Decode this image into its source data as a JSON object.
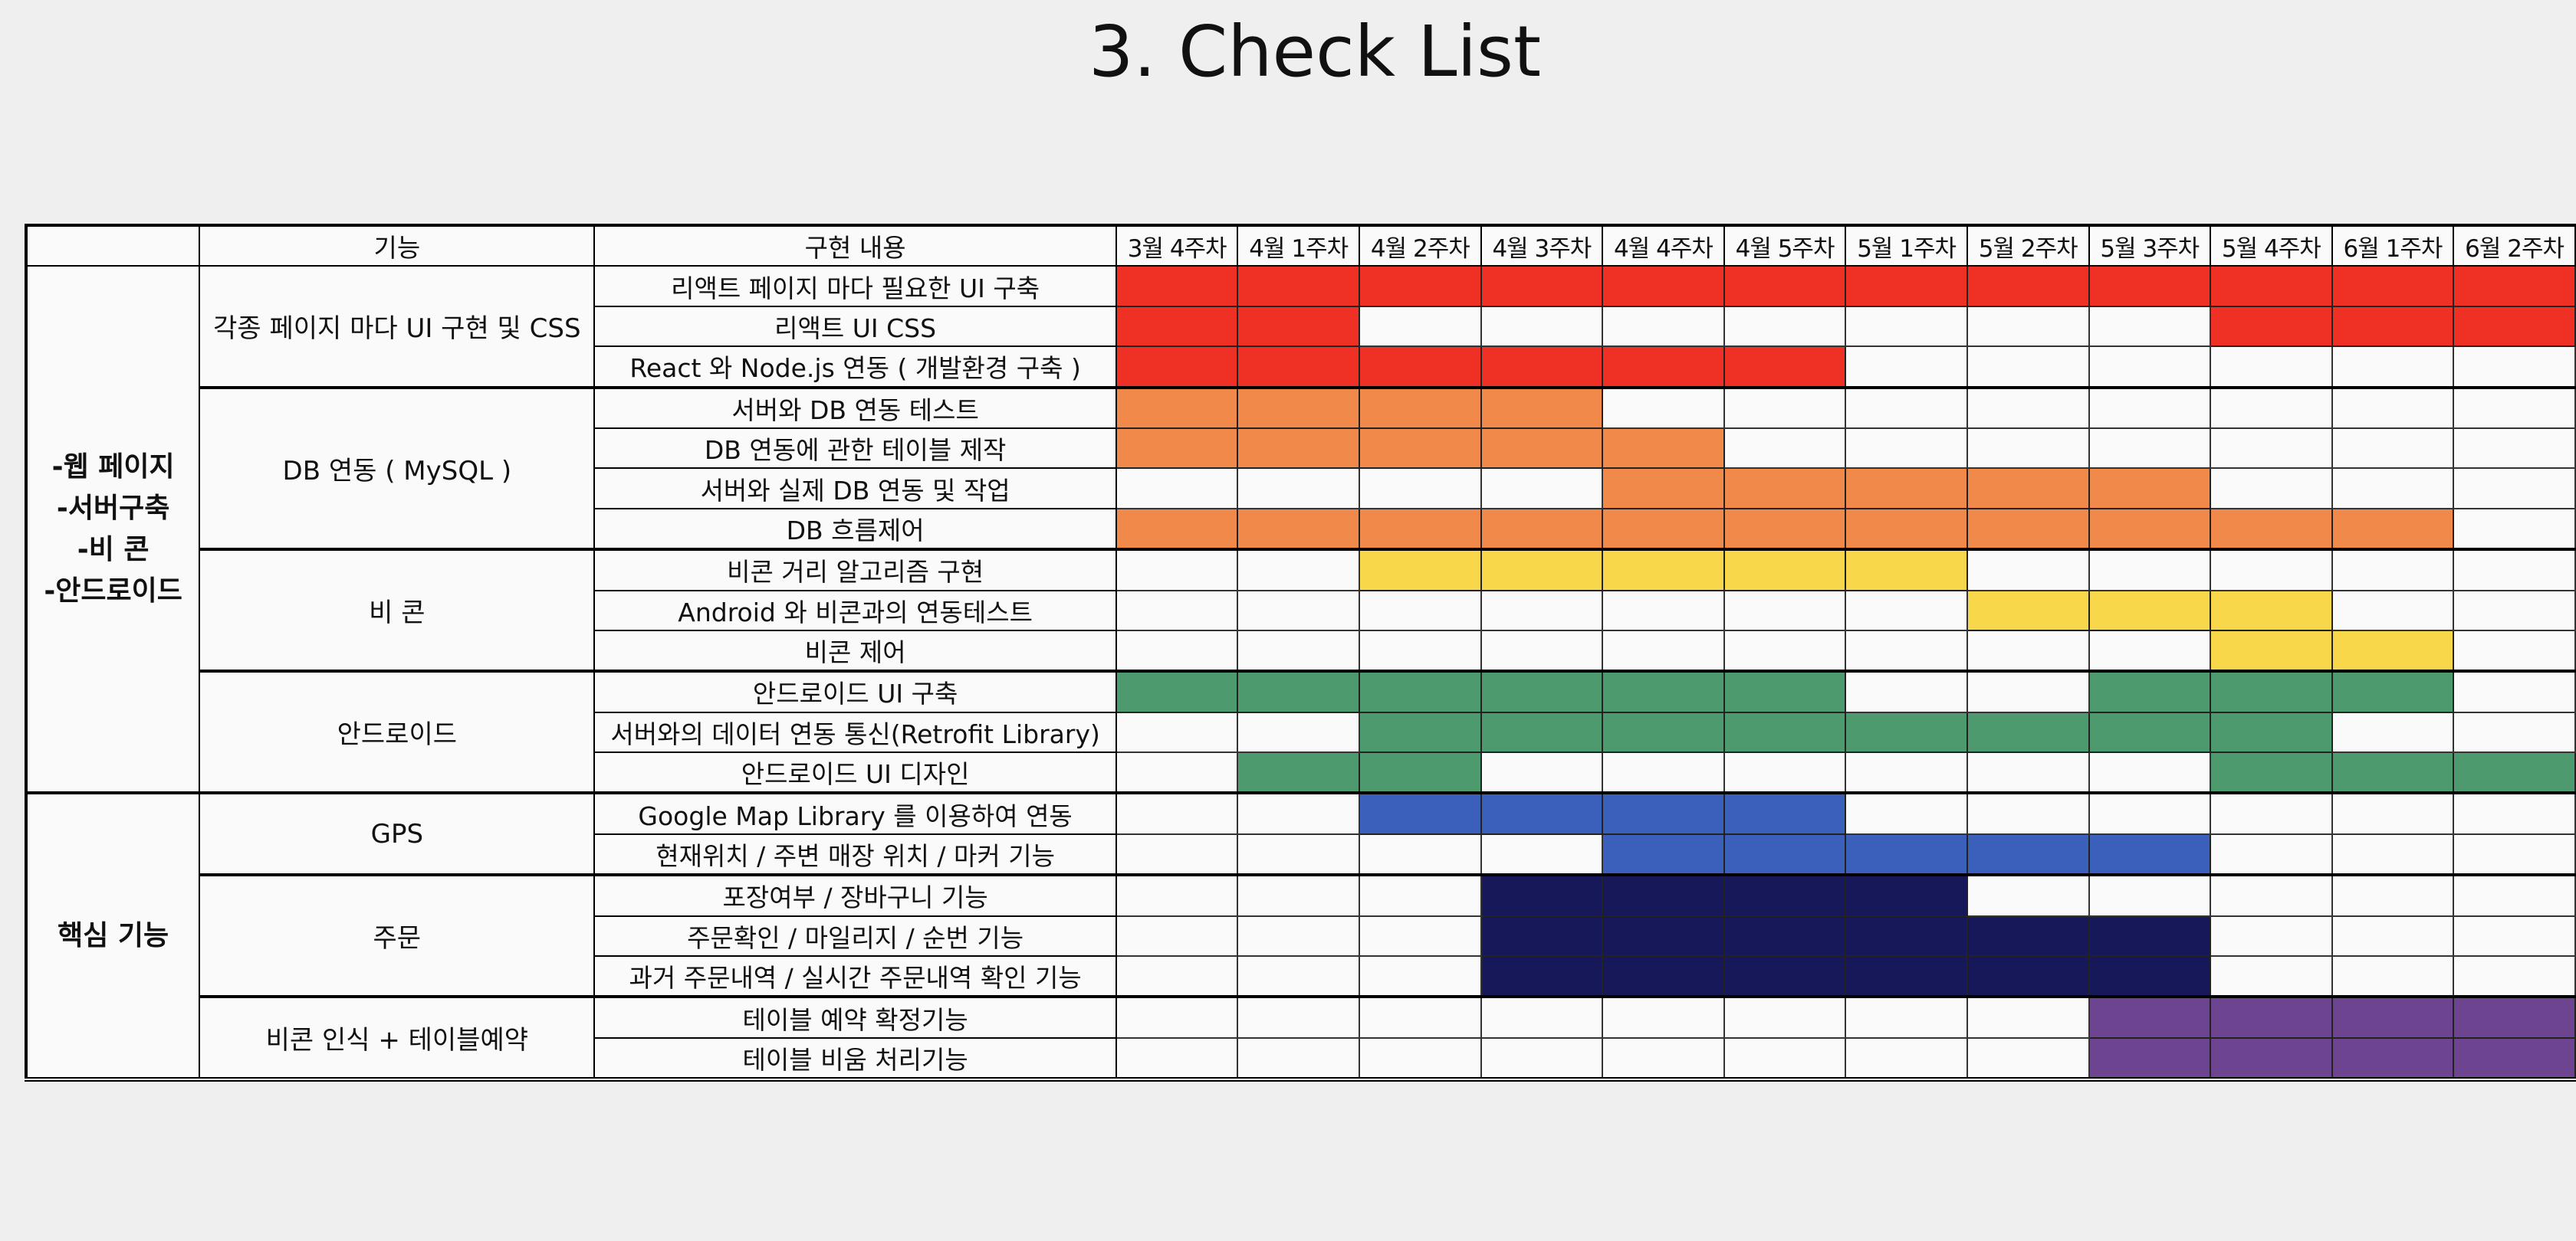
{
  "title": "3. Check List",
  "headers": {
    "feature": "기능",
    "content": "구현 내용"
  },
  "weeks": [
    "3월 4주차",
    "4월 1주차",
    "4월 2주차",
    "4월 3주차",
    "4월 4주차",
    "4월 5주차",
    "5월 1주차",
    "5월 2주차",
    "5월 3주차",
    "5월 4주차",
    "6월 1주차",
    "6월 2주차"
  ],
  "colors": {
    "red": "#ee3124",
    "orange": "#f0894a",
    "yellow": "#f8d84a",
    "green": "#4c9a6e",
    "blue": "#3a60bb",
    "navy": "#16185a",
    "purple": "#6d4490"
  },
  "sections": [
    {
      "label": "-웹 페이지\n-서버구축\n-비 콘\n-안드로이드",
      "groups": [
        {
          "feature": "각종 페이지 마다 UI 구현 및 CSS",
          "color": "red",
          "tasks": [
            {
              "name": "리액트 페이지 마다 필요한 UI 구축",
              "weeks": [
                0,
                1,
                2,
                3,
                4,
                5,
                6,
                7,
                8,
                9,
                10,
                11
              ]
            },
            {
              "name": "리액트 UI CSS",
              "weeks": [
                0,
                1,
                9,
                10,
                11
              ]
            },
            {
              "name": "React 와 Node.js 연동 ( 개발환경 구축 )",
              "weeks": [
                0,
                1,
                2,
                3,
                4,
                5
              ]
            }
          ]
        },
        {
          "feature": "DB 연동 ( MySQL )",
          "color": "orange",
          "tasks": [
            {
              "name": "서버와 DB 연동 테스트",
              "weeks": [
                0,
                1,
                2,
                3
              ]
            },
            {
              "name": "DB 연동에 관한 테이블 제작",
              "weeks": [
                0,
                1,
                2,
                3,
                4
              ]
            },
            {
              "name": "서버와 실제 DB 연동 및 작업",
              "weeks": [
                4,
                5,
                6,
                7,
                8
              ]
            },
            {
              "name": "DB 흐름제어",
              "weeks": [
                0,
                1,
                2,
                3,
                4,
                5,
                6,
                7,
                8,
                9,
                10
              ]
            }
          ]
        },
        {
          "feature": "비 콘",
          "color": "yellow",
          "tasks": [
            {
              "name": "비콘 거리 알고리즘 구현",
              "weeks": [
                2,
                3,
                4,
                5,
                6
              ]
            },
            {
              "name": "Android 와 비콘과의 연동테스트",
              "weeks": [
                7,
                8,
                9
              ]
            },
            {
              "name": "비콘 제어",
              "weeks": [
                9,
                10
              ]
            }
          ]
        },
        {
          "feature": "안드로이드",
          "color": "green",
          "tasks": [
            {
              "name": "안드로이드 UI 구축",
              "weeks": [
                0,
                1,
                2,
                3,
                4,
                5,
                8,
                9,
                10
              ]
            },
            {
              "name": "서버와의 데이터 연동 통신(Retrofit Library)",
              "weeks": [
                2,
                3,
                4,
                5,
                6,
                7,
                8,
                9
              ]
            },
            {
              "name": "안드로이드 UI 디자인",
              "weeks": [
                1,
                2,
                9,
                10,
                11
              ]
            }
          ]
        }
      ]
    },
    {
      "label": "핵심 기능",
      "groups": [
        {
          "feature": "GPS",
          "color": "blue",
          "tasks": [
            {
              "name": "Google Map Library 를 이용하여 연동",
              "weeks": [
                2,
                3,
                4,
                5
              ]
            },
            {
              "name": "현재위치 / 주변 매장 위치 / 마커 기능",
              "weeks": [
                4,
                5,
                6,
                7,
                8
              ]
            }
          ]
        },
        {
          "feature": "주문",
          "color": "navy",
          "tasks": [
            {
              "name": "포장여부 / 장바구니 기능",
              "weeks": [
                3,
                4,
                5,
                6
              ]
            },
            {
              "name": "주문확인 / 마일리지 / 순번 기능",
              "weeks": [
                3,
                4,
                5,
                6,
                7,
                8
              ]
            },
            {
              "name": "과거 주문내역 / 실시간 주문내역 확인 기능",
              "weeks": [
                3,
                4,
                5,
                6,
                7,
                8
              ]
            }
          ]
        },
        {
          "feature": "비콘 인식 + 테이블예약",
          "color": "purple",
          "tasks": [
            {
              "name": "테이블 예약 확정기능",
              "weeks": [
                8,
                9,
                10,
                11
              ]
            },
            {
              "name": "테이블 비움 처리기능",
              "weeks": [
                8,
                9,
                10,
                11
              ]
            }
          ]
        }
      ]
    }
  ]
}
